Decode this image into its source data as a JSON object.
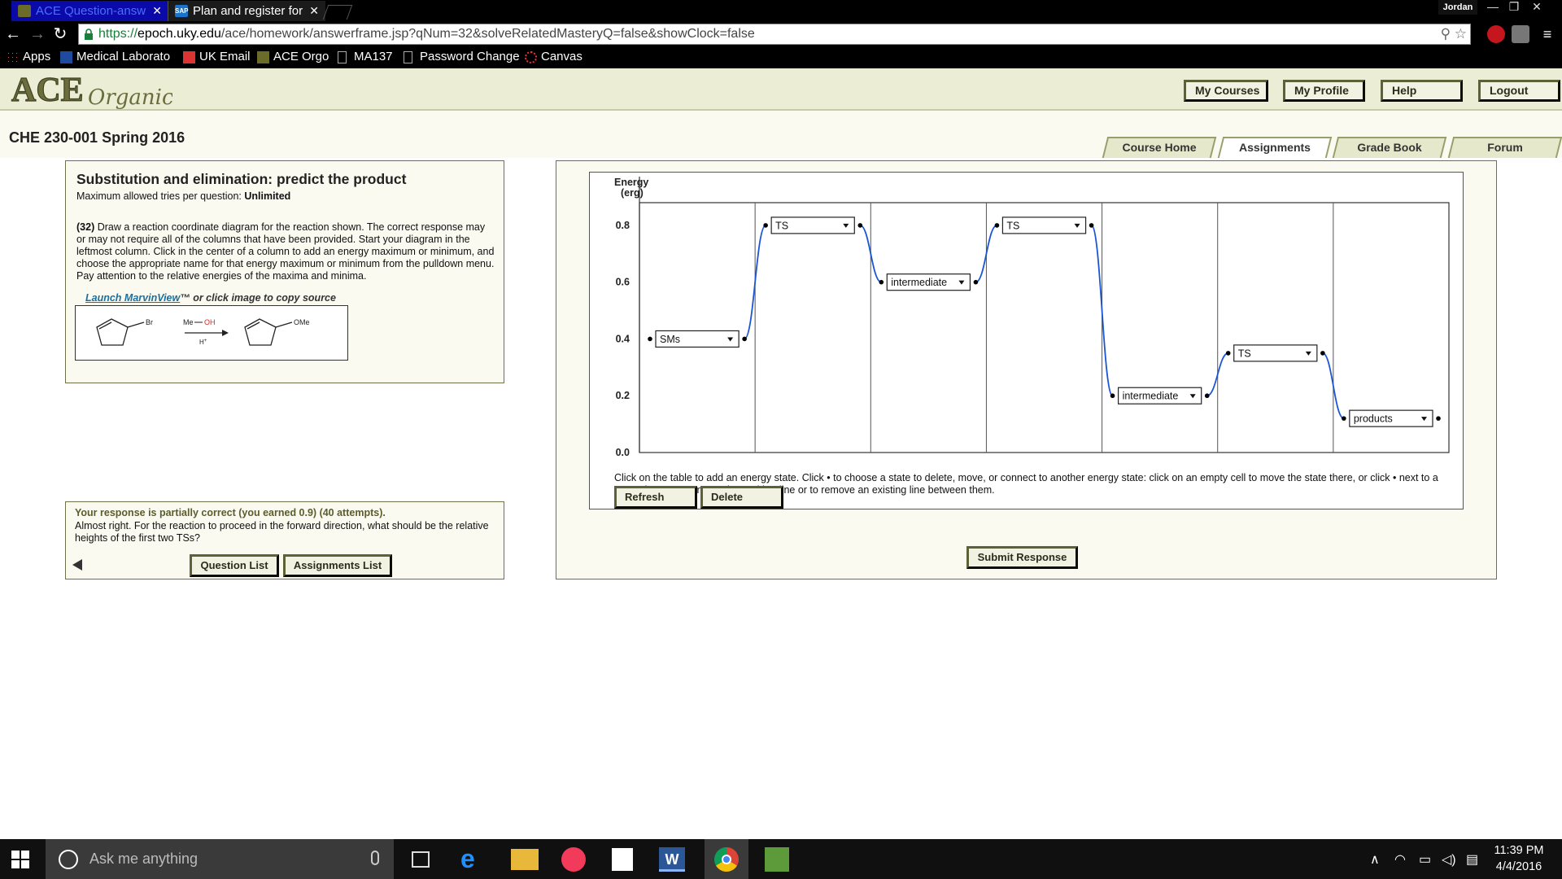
{
  "browser": {
    "tabs": [
      {
        "label": "ACE Question-answ",
        "active": true
      },
      {
        "label": "Plan and register for",
        "active": false
      }
    ],
    "user": "Jordan",
    "url_proto": "https://",
    "url_host": "epoch.uky.edu",
    "url_path": "/ace/homework/answerframe.jsp?qNum=32&solveRelatedMasteryQ=false&showClock=false",
    "bookmarks": [
      "Apps",
      "Medical Laborato",
      "UK Email",
      "ACE Orgo",
      "MA137",
      "Password Change",
      "Canvas"
    ]
  },
  "header": {
    "logo_text": "ACE",
    "logo_script": "Organic",
    "buttons": [
      "My Courses",
      "My Profile",
      "Help",
      "Logout"
    ]
  },
  "course": {
    "title": "CHE 230-001 Spring 2016",
    "tabs": [
      "Course Home",
      "Assignments",
      "Grade Book",
      "Forum"
    ],
    "active_tab": "Assignments"
  },
  "question": {
    "title": "Substitution and elimination: predict the product",
    "max_tries_label": "Maximum allowed tries per question:",
    "max_tries_value": "Unlimited",
    "number": "(32)",
    "text": "Draw a reaction coordinate diagram for the reaction shown. The correct response may or may not require all of the columns that have been provided. Start your diagram in the leftmost column. Click in the center of a column to add an energy maximum or minimum, and choose the appropriate name for that energy maximum or minimum from the pulldown menu. Pay attention to the relative energies of the maxima and minima.",
    "marvin_link": "Launch MarvinView",
    "marvin_suffix": "™ or click image to copy source",
    "reaction": {
      "reactant_sub": "Br",
      "reagent_me": "Me",
      "reagent_oh": "OH",
      "catalyst": "H",
      "catalyst_sup": "+",
      "product_sub": "OMe"
    }
  },
  "feedback": {
    "heading": "Your response is partially correct (you earned 0.9) (40 attempts).",
    "body": "Almost right. For the reaction to proceed in the forward direction, what should be the relative heights of the first two TSs?",
    "buttons": [
      "Question List",
      "Assignments List"
    ]
  },
  "diagram": {
    "yaxis_label_1": "Energy",
    "yaxis_label_2": "(erg)",
    "yticks": [
      "0.8",
      "0.6",
      "0.4",
      "0.2",
      "0.0"
    ],
    "states": [
      {
        "column": 1,
        "energy": 0.4,
        "label": "SMs"
      },
      {
        "column": 2,
        "energy": 0.8,
        "label": "TS"
      },
      {
        "column": 3,
        "energy": 0.6,
        "label": "intermediate"
      },
      {
        "column": 4,
        "energy": 0.8,
        "label": "TS"
      },
      {
        "column": 5,
        "energy": 0.2,
        "label": "intermediate"
      },
      {
        "column": 6,
        "energy": 0.35,
        "label": "TS"
      },
      {
        "column": 7,
        "energy": 0.12,
        "label": "products"
      }
    ],
    "columns": 7,
    "line_color": "#1a55d6",
    "instructions": "Click on the table to add an energy state. Click • to choose a state to delete, move, or connect to another energy state: click on an empty cell to move the state there, or click • next to a second state to connect them with a line or to remove an existing line between them.",
    "buttons": [
      "Refresh",
      "Delete"
    ],
    "submit": "Submit Response"
  },
  "taskbar": {
    "search_placeholder": "Ask me anything",
    "time": "11:39 PM",
    "date": "4/4/2016"
  }
}
